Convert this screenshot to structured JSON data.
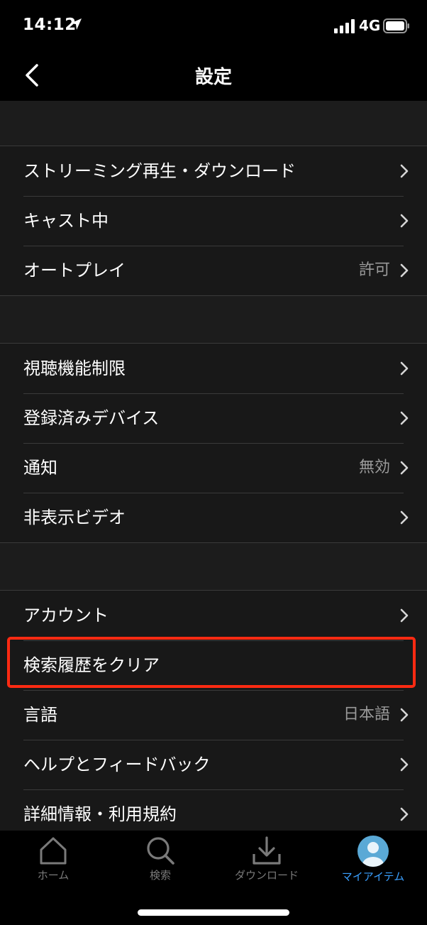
{
  "status_bar": {
    "time": "14:12",
    "network": "4G"
  },
  "nav": {
    "title": "設定"
  },
  "groups": [
    {
      "items": [
        {
          "label": "ストリーミング再生・ダウンロード",
          "value": ""
        },
        {
          "label": "キャスト中",
          "value": ""
        },
        {
          "label": "オートプレイ",
          "value": "許可"
        }
      ]
    },
    {
      "items": [
        {
          "label": "視聴機能制限",
          "value": ""
        },
        {
          "label": "登録済みデバイス",
          "value": ""
        },
        {
          "label": "通知",
          "value": "無効"
        },
        {
          "label": "非表示ビデオ",
          "value": ""
        }
      ]
    },
    {
      "items": [
        {
          "label": "アカウント",
          "value": ""
        },
        {
          "label": "検索履歴をクリア",
          "value": "",
          "highlighted": true
        },
        {
          "label": "言語",
          "value": "日本語"
        },
        {
          "label": "ヘルプとフィードバック",
          "value": ""
        },
        {
          "label": "詳細情報・利用規約",
          "value": ""
        }
      ]
    }
  ],
  "tab_bar": {
    "tabs": [
      {
        "label": "ホーム",
        "icon": "home-icon"
      },
      {
        "label": "検索",
        "icon": "search-icon"
      },
      {
        "label": "ダウンロード",
        "icon": "download-icon"
      },
      {
        "label": "マイアイテム",
        "icon": "profile-avatar-icon",
        "active": true
      }
    ]
  },
  "colors": {
    "accent": "#3aa0ff",
    "highlight": "#ff2a12",
    "background": "#000000",
    "panel": "#181818"
  }
}
